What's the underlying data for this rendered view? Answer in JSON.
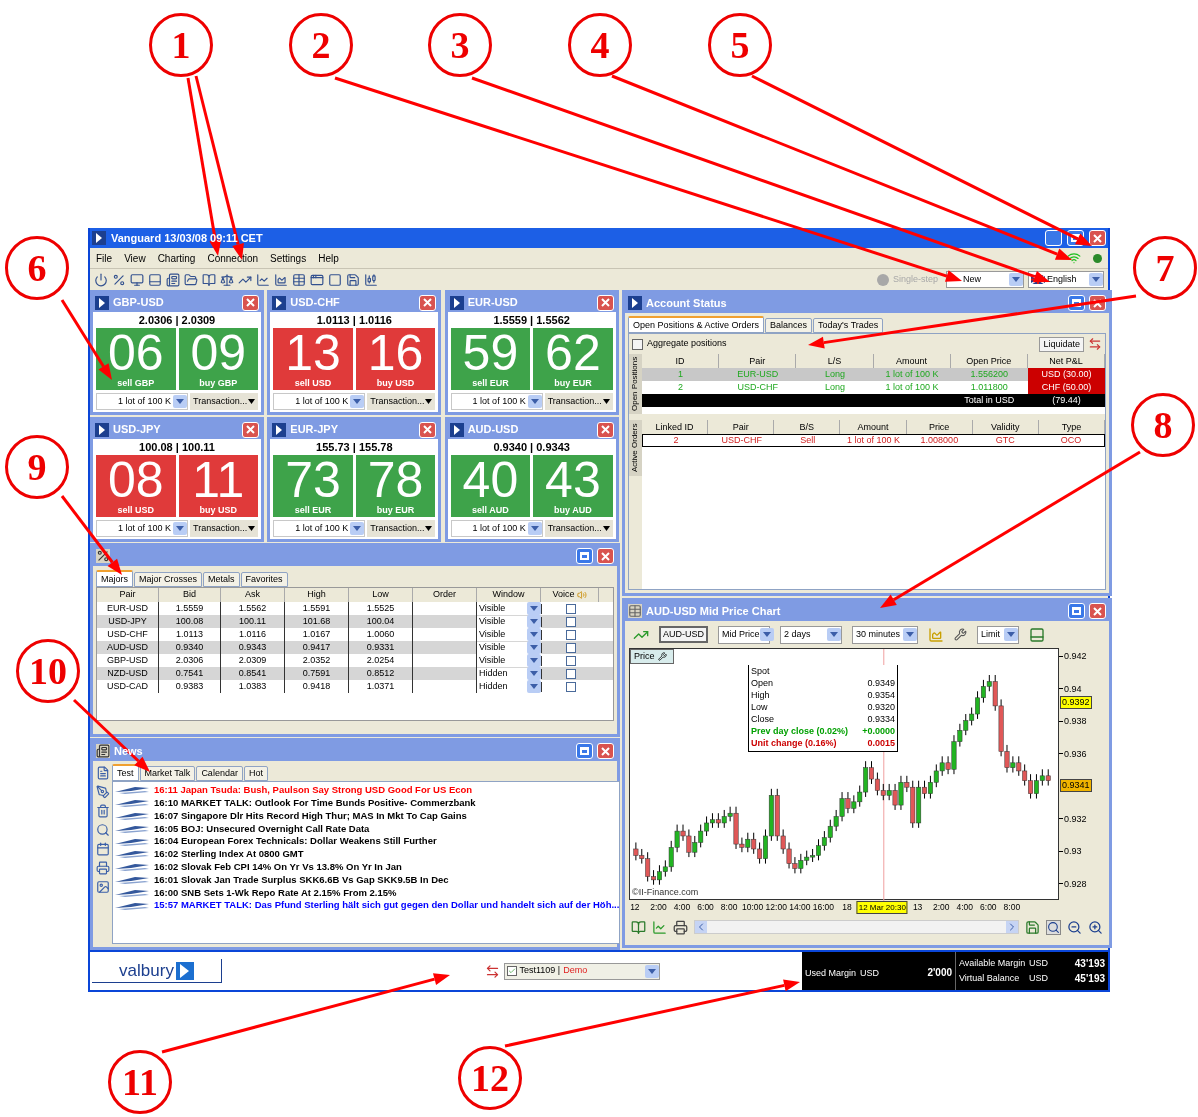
{
  "window": {
    "title": "Vanguard 13/03/08 09:11 CET"
  },
  "menu": [
    "File",
    "View",
    "Charting",
    "Connection",
    "Settings",
    "Help"
  ],
  "toolbar": {
    "single_step": {
      "label": "Single-step",
      "disabled": true
    },
    "profile": "New",
    "language": "English"
  },
  "tiles": [
    {
      "pair": "GBP-USD",
      "quote": "2.0306 | 2.0309",
      "sell": "06",
      "sell_label": "sell GBP",
      "buy": "09",
      "buy_label": "buy GBP",
      "color": "#3ea34a",
      "lot": "1 lot of 100 K",
      "transaction": "Transaction..."
    },
    {
      "pair": "USD-CHF",
      "quote": "1.0113 | 1.0116",
      "sell": "13",
      "sell_label": "sell USD",
      "buy": "16",
      "buy_label": "buy USD",
      "color": "#e03a3a",
      "lot": "1 lot of 100 K",
      "transaction": "Transaction..."
    },
    {
      "pair": "EUR-USD",
      "quote": "1.5559 | 1.5562",
      "sell": "59",
      "sell_label": "sell EUR",
      "buy": "62",
      "buy_label": "buy EUR",
      "color": "#3ea34a",
      "lot": "1 lot of 100 K",
      "transaction": "Transaction..."
    },
    {
      "pair": "USD-JPY",
      "quote": "100.08 | 100.11",
      "sell": "08",
      "sell_label": "sell USD",
      "buy": "11",
      "buy_label": "buy USD",
      "color": "#e03a3a",
      "lot": "1 lot of 100 K",
      "transaction": "Transaction..."
    },
    {
      "pair": "EUR-JPY",
      "quote": "155.73 | 155.78",
      "sell": "73",
      "sell_label": "sell EUR",
      "buy": "78",
      "buy_label": "buy EUR",
      "color": "#3ea34a",
      "lot": "1 lot of 100 K",
      "transaction": "Transaction..."
    },
    {
      "pair": "AUD-USD",
      "quote": "0.9340 | 0.9343",
      "sell": "40",
      "sell_label": "sell AUD",
      "buy": "43",
      "buy_label": "buy AUD",
      "color": "#3ea34a",
      "lot": "1 lot of 100 K",
      "transaction": "Transaction..."
    }
  ],
  "rates": {
    "tabs": [
      {
        "label": "Majors",
        "selected": true
      },
      {
        "label": "Major Crosses",
        "selected": false
      },
      {
        "label": "Metals",
        "selected": false
      },
      {
        "label": "Favorites",
        "selected": false
      }
    ],
    "columns": [
      "Pair",
      "Bid",
      "Ask",
      "High",
      "Low",
      "Order",
      "Window",
      "Voice"
    ],
    "rows": [
      {
        "pair": "EUR-USD",
        "bid": "1.5559",
        "ask": "1.5562",
        "high": "1.5591",
        "low": "1.5525",
        "window": "Visible",
        "voice": false
      },
      {
        "pair": "USD-JPY",
        "bid": "100.08",
        "ask": "100.11",
        "high": "101.68",
        "low": "100.04",
        "window": "Visible",
        "voice": false
      },
      {
        "pair": "USD-CHF",
        "bid": "1.0113",
        "ask": "1.0116",
        "high": "1.0167",
        "low": "1.0060",
        "window": "Visible",
        "voice": false
      },
      {
        "pair": "AUD-USD",
        "bid": "0.9340",
        "ask": "0.9343",
        "high": "0.9417",
        "low": "0.9331",
        "window": "Visible",
        "voice": false
      },
      {
        "pair": "GBP-USD",
        "bid": "2.0306",
        "ask": "2.0309",
        "high": "2.0352",
        "low": "2.0254",
        "window": "Visible",
        "voice": false
      },
      {
        "pair": "NZD-USD",
        "bid": "0.7541",
        "ask": "0.8541",
        "high": "0.7591",
        "low": "0.8512",
        "window": "Hidden",
        "voice": false
      },
      {
        "pair": "USD-CAD",
        "bid": "0.9383",
        "ask": "1.0383",
        "high": "0.9418",
        "low": "1.0371",
        "window": "Hidden",
        "voice": false
      }
    ]
  },
  "news": {
    "title": "News",
    "tabs": [
      {
        "label": "Test",
        "selected": true
      },
      {
        "label": "Market Talk",
        "selected": false
      },
      {
        "label": "Calendar",
        "selected": false
      },
      {
        "label": "Hot",
        "selected": false
      }
    ],
    "items": [
      {
        "text": "16:11 Japan Tsuda: Bush, Paulson Say Strong USD Good For US Econ",
        "color": "#ff0000"
      },
      {
        "text": "16:10 MARKET TALK: Outlook For Time Bunds Positive- Commerzbank",
        "color": "#000000"
      },
      {
        "text": "16:07 Singapore Dlr Hits Record High Thur; MAS In Mkt To Cap Gains",
        "color": "#000000"
      },
      {
        "text": "16:05 BOJ: Unsecured Overnight Call Rate Data",
        "color": "#000000"
      },
      {
        "text": "16:04 European Forex Technicals: Dollar Weakens Still Further",
        "color": "#000000"
      },
      {
        "text": "16:02 Sterling Index At 0800 GMT",
        "color": "#000000"
      },
      {
        "text": "16:02 Slovak Feb CPI 14% On Yr Vs 13.8% On Yr In Jan",
        "color": "#000000"
      },
      {
        "text": "16:01 Slovak Jan Trade Surplus SKK6.6B Vs Gap SKK9.5B In Dec",
        "color": "#000000"
      },
      {
        "text": "16:00 SNB Sets 1-Wk Repo Rate At 2.15% From 2.15%",
        "color": "#000000"
      },
      {
        "text": "15:57 MARKET TALK: Das Pfund Sterling hält sich gut gegen den Dollar und handelt sich auf der Höh...",
        "color": "#0000ff"
      }
    ]
  },
  "account": {
    "title": "Account Status",
    "tabs": [
      {
        "label": "Open Positions & Active Orders",
        "selected": true
      },
      {
        "label": "Balances",
        "selected": false
      },
      {
        "label": "Today's Trades",
        "selected": false
      }
    ],
    "aggregate": {
      "label": "Aggregate positions",
      "checked": false
    },
    "liquidate": "Liquidate",
    "positions_label": "Open Positions",
    "position_columns": [
      "ID",
      "Pair",
      "L/S",
      "Amount",
      "Open Price",
      "Net P&L"
    ],
    "positions": [
      {
        "id": "1",
        "pair": "EUR-USD",
        "side": "Long",
        "amount": "1 lot of 100 K",
        "open_price": "1.556200",
        "pnl": "USD (30.00)",
        "selected": true
      },
      {
        "id": "2",
        "pair": "USD-CHF",
        "side": "Long",
        "amount": "1 lot of 100 K",
        "open_price": "1.011800",
        "pnl": "CHF (50.00)",
        "selected": false
      }
    ],
    "total_label": "Total in USD",
    "total": "(79.44)",
    "orders_label": "Active Orders",
    "order_columns": [
      "Linked ID",
      "Pair",
      "B/S",
      "Amount",
      "Price",
      "Validity",
      "Type"
    ],
    "orders": [
      {
        "linked_id": "2",
        "pair": "USD-CHF",
        "side": "Sell",
        "amount": "1 lot of 100 K",
        "price": "1.008000",
        "validity": "GTC",
        "type": "OCO"
      }
    ]
  },
  "chart": {
    "title": "AUD-USD Mid Price Chart",
    "symbol": "AUD-USD",
    "price_type": "Mid Price",
    "range": "2 days",
    "interval": "30 minutes",
    "order_type": "Limit",
    "panel_label": "Price",
    "chart_data": {
      "type": "candlestick",
      "ylim": [
        0.927,
        0.9425
      ],
      "yticks": [
        0.942,
        0.94,
        0.938,
        0.936,
        0.932,
        0.93,
        0.928
      ],
      "annotations": [
        "12 Mar 20:30"
      ],
      "categories": [
        "12",
        null,
        null,
        null,
        "2:00",
        null,
        null,
        null,
        "4:00",
        null,
        null,
        null,
        "6:00",
        null,
        null,
        null,
        "8:00",
        null,
        null,
        null,
        "10:00",
        null,
        null,
        null,
        "12:00",
        null,
        null,
        null,
        "14:00",
        null,
        null,
        null,
        "16:00",
        null,
        null,
        null,
        "18",
        null,
        null,
        null,
        null,
        null,
        null,
        null,
        null,
        null,
        null,
        null,
        "13",
        null,
        null,
        null,
        "2:00",
        null,
        null,
        null,
        "4:00",
        null,
        null,
        null,
        "6:00",
        null,
        null,
        null,
        "8:00",
        null,
        null,
        null,
        null,
        null,
        null
      ],
      "ohlc": [
        [
          0.9302,
          0.9306,
          0.9295,
          0.9298
        ],
        [
          0.9298,
          0.9302,
          0.9293,
          0.9296
        ],
        [
          0.9296,
          0.93,
          0.9282,
          0.9285
        ],
        [
          0.9285,
          0.9289,
          0.928,
          0.9283
        ],
        [
          0.9283,
          0.9292,
          0.928,
          0.9288
        ],
        [
          0.9288,
          0.9295,
          0.9285,
          0.9291
        ],
        [
          0.9291,
          0.9307,
          0.9288,
          0.9303
        ],
        [
          0.9303,
          0.9317,
          0.93,
          0.9313
        ],
        [
          0.9313,
          0.9317,
          0.9307,
          0.931
        ],
        [
          0.931,
          0.9314,
          0.9297,
          0.93
        ],
        [
          0.93,
          0.931,
          0.9297,
          0.9306
        ],
        [
          0.9306,
          0.9317,
          0.9303,
          0.9313
        ],
        [
          0.9313,
          0.9322,
          0.931,
          0.9318
        ],
        [
          0.9318,
          0.9324,
          0.9315,
          0.932
        ],
        [
          0.932,
          0.9324,
          0.9315,
          0.9318
        ],
        [
          0.9318,
          0.9326,
          0.9315,
          0.9322
        ],
        [
          0.9322,
          0.9328,
          0.9319,
          0.9324
        ],
        [
          0.9324,
          0.9328,
          0.9302,
          0.9305
        ],
        [
          0.9305,
          0.9309,
          0.93,
          0.9303
        ],
        [
          0.9303,
          0.9312,
          0.93,
          0.9308
        ],
        [
          0.9308,
          0.9312,
          0.9299,
          0.9302
        ],
        [
          0.9302,
          0.9306,
          0.9293,
          0.9296
        ],
        [
          0.9296,
          0.9314,
          0.9293,
          0.931
        ],
        [
          0.931,
          0.9339,
          0.9307,
          0.9335
        ],
        [
          0.9335,
          0.9339,
          0.9307,
          0.931
        ],
        [
          0.931,
          0.9314,
          0.9299,
          0.9302
        ],
        [
          0.9302,
          0.9306,
          0.929,
          0.9293
        ],
        [
          0.9293,
          0.9297,
          0.9287,
          0.929
        ],
        [
          0.929,
          0.9299,
          0.9287,
          0.9295
        ],
        [
          0.9295,
          0.9301,
          0.9292,
          0.9297
        ],
        [
          0.9297,
          0.9302,
          0.9294,
          0.9298
        ],
        [
          0.9298,
          0.9308,
          0.9295,
          0.9304
        ],
        [
          0.9304,
          0.9313,
          0.9301,
          0.9309
        ],
        [
          0.9309,
          0.932,
          0.9306,
          0.9316
        ],
        [
          0.9316,
          0.9326,
          0.9313,
          0.9322
        ],
        [
          0.9322,
          0.9337,
          0.9319,
          0.9333
        ],
        [
          0.9333,
          0.9337,
          0.9324,
          0.9327
        ],
        [
          0.9327,
          0.9335,
          0.9324,
          0.9331
        ],
        [
          0.9331,
          0.9341,
          0.9328,
          0.9337
        ],
        [
          0.9337,
          0.9356,
          0.9334,
          0.9352
        ],
        [
          0.9352,
          0.9356,
          0.9342,
          0.9345
        ],
        [
          0.9345,
          0.9349,
          0.9335,
          0.9338
        ],
        [
          0.9338,
          0.9342,
          0.9332,
          0.9335
        ],
        [
          0.9335,
          0.9342,
          0.9332,
          0.9338
        ],
        [
          0.9338,
          0.9342,
          0.9326,
          0.9329
        ],
        [
          0.9329,
          0.9347,
          0.9326,
          0.9343
        ],
        [
          0.9343,
          0.9347,
          0.9337,
          0.934
        ],
        [
          0.934,
          0.9344,
          0.9315,
          0.9318
        ],
        [
          0.9318,
          0.9344,
          0.9315,
          0.934
        ],
        [
          0.934,
          0.9344,
          0.9333,
          0.9336
        ],
        [
          0.9336,
          0.9347,
          0.9333,
          0.9343
        ],
        [
          0.9343,
          0.9354,
          0.934,
          0.935
        ],
        [
          0.935,
          0.9359,
          0.9347,
          0.9355
        ],
        [
          0.9355,
          0.9359,
          0.9348,
          0.9351
        ],
        [
          0.9351,
          0.9372,
          0.9348,
          0.9368
        ],
        [
          0.9368,
          0.9379,
          0.9365,
          0.9375
        ],
        [
          0.9375,
          0.9385,
          0.9372,
          0.9381
        ],
        [
          0.9381,
          0.9389,
          0.9378,
          0.9385
        ],
        [
          0.9385,
          0.9399,
          0.9382,
          0.9395
        ],
        [
          0.9395,
          0.9406,
          0.9392,
          0.9402
        ],
        [
          0.9402,
          0.9409,
          0.9399,
          0.9405
        ],
        [
          0.9405,
          0.9409,
          0.9387,
          0.939
        ],
        [
          0.939,
          0.9394,
          0.9359,
          0.9362
        ],
        [
          0.9362,
          0.9366,
          0.9349,
          0.9352
        ],
        [
          0.9352,
          0.9359,
          0.9349,
          0.9355
        ],
        [
          0.9355,
          0.9359,
          0.9347,
          0.935
        ],
        [
          0.935,
          0.9354,
          0.9341,
          0.9344
        ],
        [
          0.9344,
          0.9348,
          0.9333,
          0.9336
        ],
        [
          0.9336,
          0.9348,
          0.9333,
          0.9344
        ],
        [
          0.9344,
          0.9351,
          0.9341,
          0.9347
        ],
        [
          0.9347,
          0.9351,
          0.9341,
          0.9344
        ]
      ]
    },
    "price_tags": [
      {
        "text": "0.9392",
        "color": "#ffff00"
      },
      {
        "text": "0.9341",
        "color": "#f0b400"
      }
    ],
    "tooltip": [
      {
        "label": "Spot",
        "kind": "plain"
      },
      {
        "label": "Open",
        "value": "0.9349",
        "kind": "plain"
      },
      {
        "label": "High",
        "value": "0.9354",
        "kind": "plain"
      },
      {
        "label": "Low",
        "value": "0.9320",
        "kind": "plain"
      },
      {
        "label": "Close",
        "value": "0.9334",
        "kind": "plain"
      },
      {
        "label": "Prev day close (0.02%)",
        "value": "+0.0000",
        "kind": "gain"
      },
      {
        "label": "Unit change (0.16%)",
        "value": "0.0015",
        "kind": "loss"
      }
    ],
    "watermark": "©II-Finance.com"
  },
  "footer": {
    "brand": "valbury",
    "account": "Test1109 |",
    "mode": "Demo",
    "used_margin_label": "Used Margin",
    "used_margin_currency": "USD",
    "used_margin": "2'000",
    "balances": [
      {
        "label": "Available Margin",
        "currency": "USD",
        "value": "43'193"
      },
      {
        "label": "Virtual Balance",
        "currency": "USD",
        "value": "45'193"
      }
    ]
  },
  "callouts": [
    "1",
    "2",
    "3",
    "4",
    "5",
    "6",
    "7",
    "8",
    "9",
    "10",
    "11",
    "12"
  ]
}
